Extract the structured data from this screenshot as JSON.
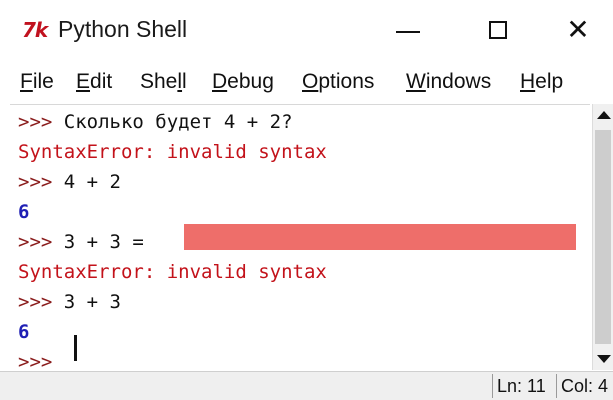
{
  "window": {
    "title": "Python Shell",
    "icon_text": "7k"
  },
  "menu": [
    {
      "before": "",
      "underlined": "F",
      "after": "ile"
    },
    {
      "before": "",
      "underlined": "E",
      "after": "dit"
    },
    {
      "before": "She",
      "underlined": "l",
      "after": "l"
    },
    {
      "before": "",
      "underlined": "D",
      "after": "ebug"
    },
    {
      "before": "",
      "underlined": "O",
      "after": "ptions"
    },
    {
      "before": "",
      "underlined": "W",
      "after": "indows"
    },
    {
      "before": "",
      "underlined": "H",
      "after": "elp"
    }
  ],
  "shell": {
    "prompt": ">>>",
    "lines": [
      {
        "prompt": ">>>",
        "text": " Сколько будет 4 + 2?"
      },
      {
        "error": "SyntaxError: invalid syntax"
      },
      {
        "prompt": ">>>",
        "text": " 4 + 2"
      },
      {
        "output": "6"
      },
      {
        "prompt": ">>>",
        "text": " 3 + 3 ="
      },
      {
        "error": "SyntaxError: invalid syntax"
      },
      {
        "prompt": ">>>",
        "text": " 3 + 3"
      },
      {
        "output": "6"
      },
      {
        "prompt": ">>>",
        "text": " "
      }
    ]
  },
  "status": {
    "ln": "Ln: 11",
    "col": "Col: 4"
  },
  "colors": {
    "error_red": "#c3121a",
    "output_blue": "#1f1fb4",
    "highlight": "#ee6e6a"
  }
}
